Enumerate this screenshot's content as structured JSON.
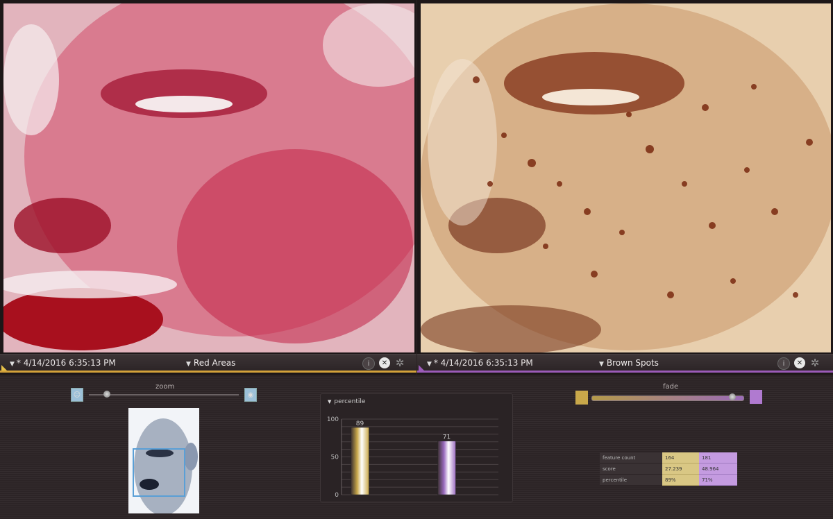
{
  "panels": [
    {
      "timestamp": "* 4/14/2016 6:35:13 PM",
      "title": "Red Areas",
      "accent": "#d4a23a",
      "tint": "#c41e3a"
    },
    {
      "timestamp": "* 4/14/2016 6:35:13 PM",
      "title": "Brown Spots",
      "accent": "#9b5bb8",
      "tint": "#8a3a1a"
    }
  ],
  "zoom": {
    "label": "zoom",
    "level": 0.12
  },
  "fade": {
    "label": "fade",
    "level": 0.93
  },
  "chart_data": {
    "type": "bar",
    "title": "percentile",
    "categories": [
      "Red Areas",
      "Brown Spots"
    ],
    "values": [
      89,
      71
    ],
    "ylim": [
      0,
      100
    ],
    "yticks": [
      "0",
      "50",
      "100"
    ],
    "colors": [
      "#c9a84a",
      "#9b6bc0"
    ],
    "grid": true
  },
  "stats": {
    "rows": [
      {
        "label": "feature count",
        "v1": "164",
        "v2": "181"
      },
      {
        "label": "score",
        "v1": "27.239",
        "v2": "48.964"
      },
      {
        "label": "percentile",
        "v1": "89%",
        "v2": "71%"
      }
    ]
  }
}
